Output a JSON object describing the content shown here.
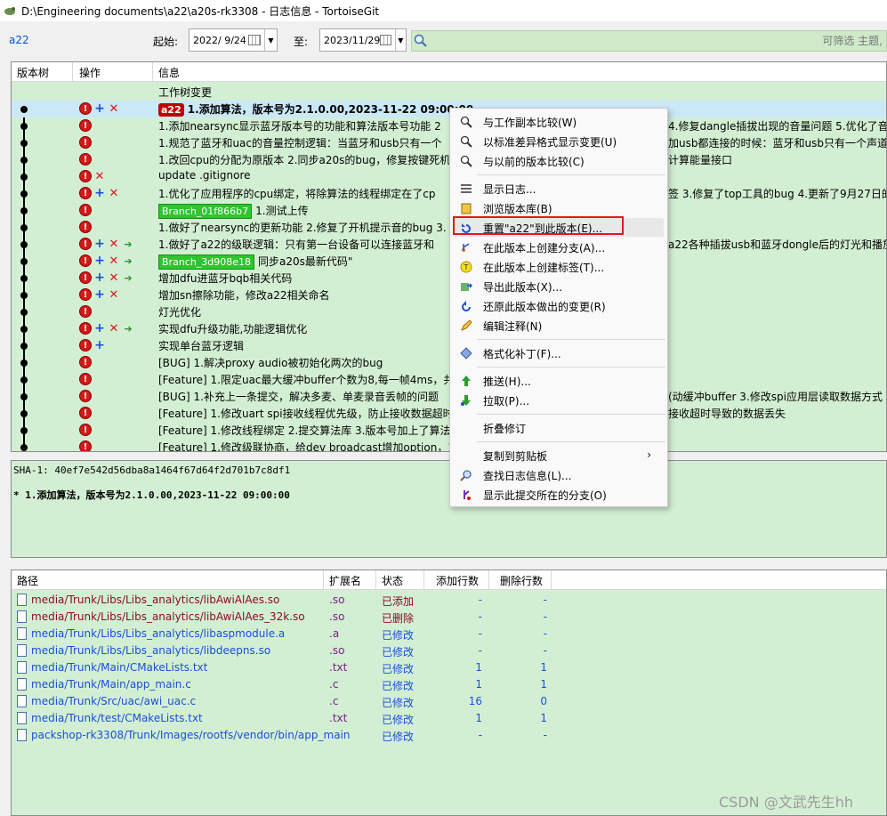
{
  "window": {
    "title": "D:\\Engineering documents\\a22\\a20s-rk3308 - 日志信息 - TortoiseGit"
  },
  "filter": {
    "branch": "a22",
    "from_label": "起始:",
    "from_date": "2022/ 9/24",
    "to_label": "至:",
    "to_date": "2023/11/29",
    "search_placeholder": "可筛选 主题,"
  },
  "log": {
    "columns": [
      "版本树",
      "操作",
      "信息"
    ],
    "rows": [
      {
        "message": "工作树变更",
        "ops": [],
        "tag": "",
        "tag_color": ""
      },
      {
        "message": "1.添加算法，版本号为2.1.0.00,2023-11-22 09:00:00",
        "ops": [
          "warn",
          "add",
          "del"
        ],
        "tag": "a22",
        "tag_color": "red",
        "bold": true
      },
      {
        "message": "1.添加nearsync显示蓝牙版本号的功能和算法版本号功能 2",
        "ops": [
          "warn"
        ],
        "tag": "",
        "tag_color": ""
      },
      {
        "message": "1.规范了蓝牙和uac的音量控制逻辑：当蓝牙和usb只有一个",
        "ops": [
          "warn"
        ],
        "tag": "",
        "tag_color": ""
      },
      {
        "message": "1.改回cpu的分配为原版本 2.同步a20s的bug，修复按键死机",
        "ops": [
          "warn"
        ],
        "tag": "",
        "tag_color": ""
      },
      {
        "message": "update .gitignore",
        "ops": [
          "warn",
          "del"
        ],
        "tag": "",
        "tag_color": ""
      },
      {
        "message": "1.优化了应用程序的cpu绑定，将除算法的线程绑定在了cp",
        "ops": [
          "warn",
          "add",
          "del"
        ],
        "tag": "",
        "tag_color": ""
      },
      {
        "message": "1.测试上传",
        "ops": [
          "warn"
        ],
        "tag": "Branch_01f866b7",
        "tag_color": "green"
      },
      {
        "message": "1.做好了nearsync的更新功能 2.修复了开机提示音的bug 3.",
        "ops": [
          "warn"
        ],
        "tag": "",
        "tag_color": ""
      },
      {
        "message": "1.做好了a22的级联逻辑：只有第一台设备可以连接蓝牙和",
        "ops": [
          "warn",
          "add",
          "del",
          "mv"
        ],
        "tag": "",
        "tag_color": ""
      },
      {
        "message": "同步a20s最新代码\"",
        "ops": [
          "warn",
          "add",
          "del",
          "mv"
        ],
        "tag": "Branch_3d908e18",
        "tag_color": "green"
      },
      {
        "message": "增加dfu进蓝牙bqb相关代码",
        "ops": [
          "warn",
          "add",
          "del",
          "mv"
        ],
        "tag": "",
        "tag_color": ""
      },
      {
        "message": "增加sn擦除功能，修改a22相关命名",
        "ops": [
          "warn",
          "add",
          "del"
        ],
        "tag": "",
        "tag_color": ""
      },
      {
        "message": "灯光优化",
        "ops": [
          "warn"
        ],
        "tag": "",
        "tag_color": ""
      },
      {
        "message": "实现dfu升级功能,功能逻辑优化",
        "ops": [
          "warn",
          "add",
          "del",
          "mv"
        ],
        "tag": "",
        "tag_color": ""
      },
      {
        "message": "实现单台蓝牙逻辑",
        "ops": [
          "warn",
          "add"
        ],
        "tag": "",
        "tag_color": ""
      },
      {
        "message": "[BUG] 1.解决proxy audio被初始化两次的bug",
        "ops": [
          "warn"
        ],
        "tag": "",
        "tag_color": ""
      },
      {
        "message": "[Feature] 1.限定uac最大缓冲buffer个数为8,每一帧4ms，共3",
        "ops": [
          "warn"
        ],
        "tag": "",
        "tag_color": ""
      },
      {
        "message": "[BUG] 1.补充上一条提交，解决多麦、单麦录音丢帧的问题",
        "ops": [
          "warn"
        ],
        "tag": "",
        "tag_color": ""
      },
      {
        "message": "[Feature] 1.修改uart spi接收线程优先级，防止接收数据超时",
        "ops": [
          "warn"
        ],
        "tag": "",
        "tag_color": ""
      },
      {
        "message": "[Feature] 1.修改线程绑定 2.提交算法库 3.版本号加上了算法",
        "ops": [
          "warn"
        ],
        "tag": "",
        "tag_color": ""
      },
      {
        "message": "[Feature] 1.修改级联协商，给dev broadcast增加option，106",
        "ops": [
          "warn"
        ],
        "tag": "",
        "tag_color": ""
      }
    ],
    "right_fragments": [
      {
        "text": "4.修复dangle插拔出现的音量问题 5.优化了音",
        "row": 2
      },
      {
        "text": "加usb都连接的时候：蓝牙和usb只有一个声道",
        "row": 3
      },
      {
        "text": "计算能量接口",
        "row": 4
      },
      {
        "text": "签 3.修复了top工具的bug 4.更新了9月27日的",
        "row": 6
      },
      {
        "text": "a22各种插拔usb和蓝牙dongle后的灯光和播放",
        "row": 9
      },
      {
        "text": "(动缓冲buffer 3.修改spi应用层读取数据方式",
        "row": 18
      },
      {
        "text": "接收超时导致的数据丢失",
        "row": 19
      }
    ]
  },
  "message_panel": {
    "sha": "SHA-1: 40ef7e542d56dba8a1464f67d64f2d701b7c8df1",
    "body": "* 1.添加算法，版本号为2.1.0.00,2023-11-22 09:00:00"
  },
  "files": {
    "columns": [
      "路径",
      "扩展名",
      "状态",
      "添加行数",
      "删除行数"
    ],
    "rows": [
      {
        "path": "media/Trunk/Libs/Libs_analytics/libAwiAlAes.so",
        "ext": ".so",
        "status": "已添加",
        "added": "-",
        "deleted": "-",
        "status_color": "#8b0a2c"
      },
      {
        "path": "media/Trunk/Libs/Libs_analytics/libAwiAlAes_32k.so",
        "ext": ".so",
        "status": "已删除",
        "added": "-",
        "deleted": "-",
        "status_color": "#8b0a2c"
      },
      {
        "path": "media/Trunk/Libs/Libs_analytics/libaspmodule.a",
        "ext": ".a",
        "status": "已修改",
        "added": "-",
        "deleted": "-",
        "status_color": "#1a4fd6"
      },
      {
        "path": "media/Trunk/Libs/Libs_analytics/libdeepns.so",
        "ext": ".so",
        "status": "已修改",
        "added": "-",
        "deleted": "-",
        "status_color": "#1a4fd6"
      },
      {
        "path": "media/Trunk/Main/CMakeLists.txt",
        "ext": ".txt",
        "status": "已修改",
        "added": "1",
        "deleted": "1",
        "status_color": "#1a4fd6"
      },
      {
        "path": "media/Trunk/Main/app_main.c",
        "ext": ".c",
        "status": "已修改",
        "added": "1",
        "deleted": "1",
        "status_color": "#1a4fd6"
      },
      {
        "path": "media/Trunk/Src/uac/awi_uac.c",
        "ext": ".c",
        "status": "已修改",
        "added": "16",
        "deleted": "0",
        "status_color": "#1a4fd6"
      },
      {
        "path": "media/Trunk/test/CMakeLists.txt",
        "ext": ".txt",
        "status": "已修改",
        "added": "1",
        "deleted": "1",
        "status_color": "#1a4fd6"
      },
      {
        "path": "packshop-rk3308/Trunk/Images/rootfs/vendor/bin/app_main",
        "ext": "",
        "status": "已修改",
        "added": "-",
        "deleted": "-",
        "status_color": "#1a4fd6"
      }
    ]
  },
  "context_menu": {
    "items": [
      {
        "label": "与工作副本比较(W)",
        "icon": "magnifier-icon"
      },
      {
        "label": "以标准差异格式显示变更(U)",
        "icon": "magnifier-icon"
      },
      {
        "label": "与以前的版本比较(C)",
        "icon": "magnifier-icon"
      },
      {
        "separator": true
      },
      {
        "label": "显示日志...",
        "icon": "log-icon"
      },
      {
        "label": "浏览版本库(B)",
        "icon": "repo-icon"
      },
      {
        "label": "重置\"a22\"到此版本(E)...",
        "icon": "reset-icon",
        "highlighted": true
      },
      {
        "label": "在此版本上创建分支(A)...",
        "icon": "branch-icon"
      },
      {
        "label": "在此版本上创建标签(T)...",
        "icon": "tag-icon"
      },
      {
        "label": "导出此版本(X)...",
        "icon": "export-icon"
      },
      {
        "label": "还原此版本做出的变更(R)",
        "icon": "revert-icon"
      },
      {
        "label": "编辑注释(N)",
        "icon": "edit-icon"
      },
      {
        "separator": true
      },
      {
        "label": "格式化补丁(F)...",
        "icon": "patch-icon"
      },
      {
        "separator": true
      },
      {
        "label": "推送(H)...",
        "icon": "push-icon"
      },
      {
        "label": "拉取(P)...",
        "icon": "pull-icon"
      },
      {
        "separator": true
      },
      {
        "label": "折叠修订",
        "icon": ""
      },
      {
        "separator": true
      },
      {
        "label": "复制到剪贴板",
        "icon": "",
        "submenu": true
      },
      {
        "label": "查找日志信息(L)...",
        "icon": "find-icon"
      },
      {
        "label": "显示此提交所在的分支(O)",
        "icon": "branches-icon"
      }
    ]
  },
  "watermark": "CSDN @文武先生hh",
  "colors": {
    "panel_bg": "#d3efd3",
    "selected_row": "#cbe8f6",
    "highlight_border": "#e0191e"
  }
}
